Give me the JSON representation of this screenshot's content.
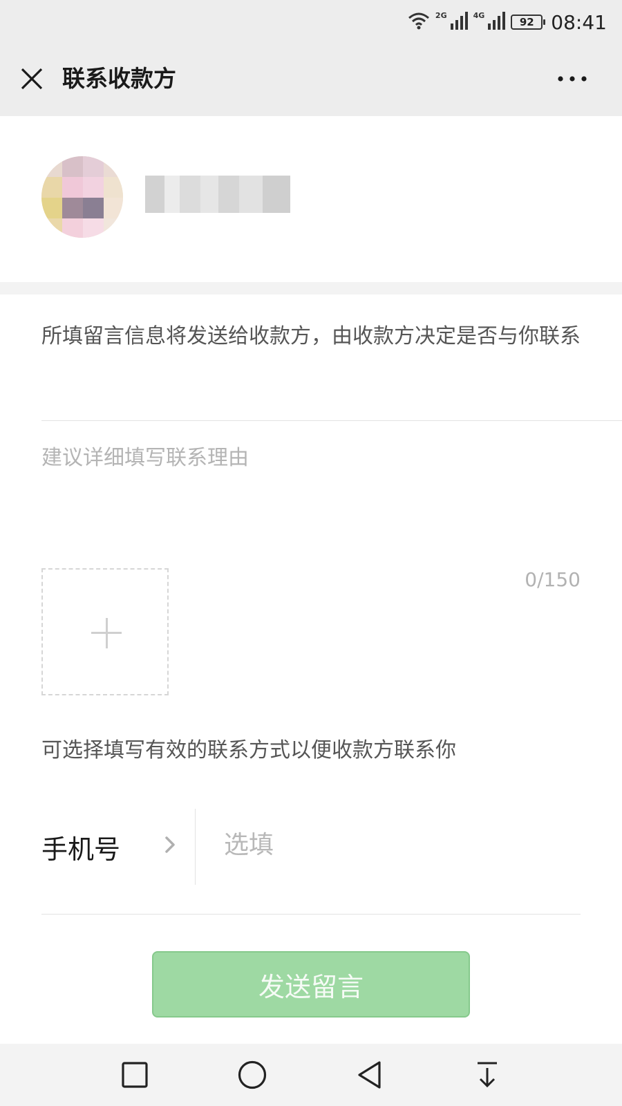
{
  "status_bar": {
    "network_1": "2G",
    "network_2": "4G",
    "battery": "92",
    "time": "08:41"
  },
  "nav": {
    "title": "联系收款方",
    "close_icon": "close-icon",
    "more_icon": "more-icon"
  },
  "payee": {
    "avatar_icon": "avatar-pixelated",
    "name_redacted": true
  },
  "form": {
    "notice": "所填留言信息将发送给收款方，由收款方决定是否与你联系",
    "reason_placeholder": "建议详细填写联系理由",
    "reason_value": "",
    "counter": "0/150",
    "add_image_icon": "plus-icon",
    "contact_hint": "可选择填写有效的联系方式以便收款方联系你",
    "phone_label": "手机号",
    "phone_placeholder": "选填",
    "phone_value": "",
    "send_button": "发送留言"
  },
  "colors": {
    "nav_bg": "#ededed",
    "button_bg": "#9ed9a3",
    "button_text": "#f6fbf6",
    "placeholder": "#b4b4b4"
  },
  "system_nav": {
    "recents_icon": "square-icon",
    "home_icon": "circle-icon",
    "back_icon": "triangle-back-icon",
    "extra_icon": "download-icon"
  }
}
